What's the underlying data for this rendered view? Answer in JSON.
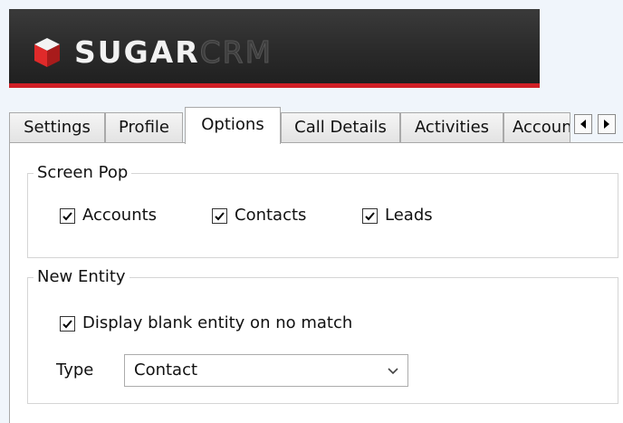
{
  "brand": {
    "name_primary": "SUGAR",
    "name_secondary": "CRM",
    "stripe_color": "#d01f26",
    "logo_cube_color": "#e02a2a"
  },
  "tabs": [
    {
      "label": "Settings",
      "active": false
    },
    {
      "label": "Profile",
      "active": false
    },
    {
      "label": "Options",
      "active": true
    },
    {
      "label": "Call Details",
      "active": false
    },
    {
      "label": "Activities",
      "active": false
    },
    {
      "label": "Accounts",
      "active": false
    }
  ],
  "tab_scroll": {
    "left_icon": "triangle-left-icon",
    "right_icon": "triangle-right-icon"
  },
  "screen_pop": {
    "title": "Screen Pop",
    "options": [
      {
        "label": "Accounts",
        "checked": true
      },
      {
        "label": "Contacts",
        "checked": true
      },
      {
        "label": "Leads",
        "checked": true
      }
    ]
  },
  "new_entity": {
    "title": "New Entity",
    "display_blank": {
      "label": "Display blank entity on no match",
      "checked": true
    },
    "type_label": "Type",
    "type_value": "Contact"
  }
}
